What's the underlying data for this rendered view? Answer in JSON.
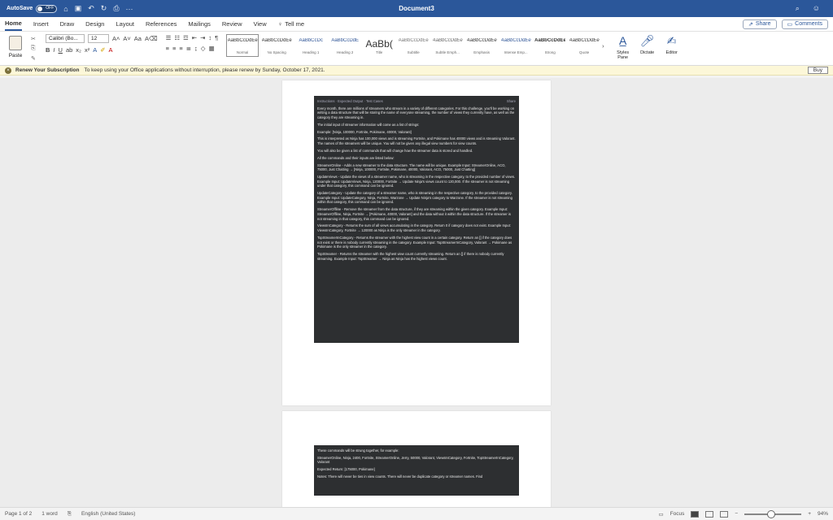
{
  "titlebar": {
    "autosave": "AutoSave",
    "autosave_state": "OFF",
    "doc_title": "Document3",
    "more": "···"
  },
  "tabs": [
    {
      "label": "Home",
      "active": true
    },
    {
      "label": "Insert"
    },
    {
      "label": "Draw"
    },
    {
      "label": "Design"
    },
    {
      "label": "Layout"
    },
    {
      "label": "References"
    },
    {
      "label": "Mailings"
    },
    {
      "label": "Review"
    },
    {
      "label": "View"
    }
  ],
  "tell_me": "Tell me",
  "share": "Share",
  "comments": "Comments",
  "ribbon": {
    "paste": "Paste",
    "font_name": "Calibri (Bo...",
    "font_size": "12",
    "styles": [
      {
        "sample": "AaBbCcDdEe",
        "name": "Normal",
        "selected": true
      },
      {
        "sample": "AaBbCcDdEe",
        "name": "No Spacing"
      },
      {
        "sample": "AaBbCcDc",
        "name": "Heading 1"
      },
      {
        "sample": "AaBbCcDdE",
        "name": "Heading 2"
      },
      {
        "sample": "AaBb(",
        "name": "Title",
        "big": true
      },
      {
        "sample": "AaBbCcDdEe",
        "name": "Subtitle"
      },
      {
        "sample": "AaBbCcDdEe",
        "name": "Subtle Emph..."
      },
      {
        "sample": "AaBbCcDdEe",
        "name": "Emphasis"
      },
      {
        "sample": "AaBbCcDdEe",
        "name": "Intense Emp..."
      },
      {
        "sample": "AaBbCcDdEe",
        "name": "Strong"
      },
      {
        "sample": "AaBbCcDdEe",
        "name": "Quote"
      }
    ],
    "styles_pane": "Styles Pane",
    "dictate": "Dictate",
    "editor": "Editor"
  },
  "message_bar": {
    "title": "Renew Your Subscription",
    "text": "To keep using your Office applications without interruption, please renew by Sunday, October 17, 2021.",
    "buy": "Buy"
  },
  "page1": {
    "code_header_left": "Instructions · Expected Output · Test Cases",
    "code_header_right": "Share",
    "paragraphs": [
      "Every month, there are millions of streamers who stream in a variety of different categories. For this challenge, you'll be working on writing a data structure that will be storing the name of everyone streaming, the number of views they currently have, as well as the category they are streaming in.",
      "The initial input of streamer information will come as a list of strings:",
      "Example: [Ninja, 100000, Fortnite, Pokimane, 40000, Valorant]",
      "This is interpreted as Ninja has 100,000 views and is streaming Fortnite, and Pokimane has 40000 views and is streaming Valorant. The names of the streamers will be unique. You will not be given any illegal view numbers for view counts.",
      "You will also be given a list of commands that will change how the streamer data is stored and handled.",
      "All the commands and their inputs are listed below:",
      "StreamerOnline - Adds a new streamer to the data structure. The name will be unique. Example Input: StreamerOnline, ACO, 75000, Just Chatting → [Ninja, 100000, Fortnite, Pokimane, 40000, Valorant, ACO, 75000, Just Chatting]",
      "UpdateViews - Update the views of a streamer name, who is streaming in the respective category, to the provided number of views. Example Input: UpdateViews, Ninja, 120000, Fortnite → Update Ninja's views count to 120,000. If the streamer is not streaming under that category, this command can be ignored.",
      "UpdateCategory - Update the category of a streamer name, who is streaming in the respective category, to the provided category. Example Input: UpdateCategory, Ninja, Fortnite, Warzone → Update Ninja's category to Warzone. If the streamer is not streaming within that category, this command can be ignored.",
      "StreamerOffline - Remove the streamer from the data structure, if they are streaming within the given category. Example Input: StreamerOffline, Ninja, Fortnite → [Pokimane, 40000, Valorant] and the data without it within the data structure. If the streamer is not streaming in that category, this command can be ignored.",
      "ViewsInCategory - Returns the sum of all views accumulating in the category. Return 0 if category does not exist. Example Input: ViewsInCategory, Fortnite → 120000 as Ninja is the only streamer in the category.",
      "TopStreamerInCategory - Returns the streamer with the highest view count in a certain category. Return an [] if the category does not exist or there is nobody currently streaming in the category. Example Input: TopStreamerInCategory, Valorant → Pokimane as Pokimane is the only streamer in the category.",
      "TopStreamer - Returns the streamer with the highest view count currently streaming. Return an [] if there is nobody currently streaming. Example Input: TopStreamer → Ninja as Ninja has the highest views count."
    ]
  },
  "page2": {
    "paragraphs": [
      "These commands will be strung together, for example:",
      "StreamerOnline, Ninja, 2400, Fortnite, StreamerOnline, Jerry, 50000, Valorant, ViewsInCategory, Fortnite, TopStreamerInCategory, Valorant",
      "Expected Return: [175000, Pokimane]",
      "Notes: There will never be ties in view counts. There will never be duplicate category or streamer names. Find"
    ]
  },
  "status": {
    "page": "Page 1 of 2",
    "words": "1 word",
    "language": "English (United States)",
    "focus": "Focus",
    "zoom": "94%",
    "zoom_fraction": 0.47
  }
}
